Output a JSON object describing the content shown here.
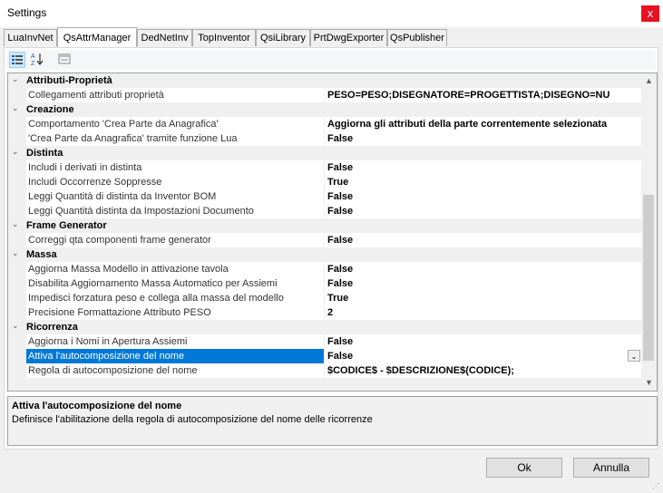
{
  "window": {
    "title": "Settings",
    "close_glyph": "x"
  },
  "tabs": [
    {
      "label": "LuaInvNet"
    },
    {
      "label": "QsAttrManager"
    },
    {
      "label": "DedNetInv"
    },
    {
      "label": "TopInventor"
    },
    {
      "label": "QsiLibrary"
    },
    {
      "label": "PrtDwgExporter"
    },
    {
      "label": "QsPublisher"
    }
  ],
  "toolbar": {
    "categorized_icon": "categorized-icon",
    "alphabetical_icon": "sort-az-icon",
    "pages_icon": "property-pages-icon"
  },
  "grid": {
    "rows": [
      {
        "type": "cat",
        "label": "Attributi-Proprietà"
      },
      {
        "type": "prop",
        "label": "Collegamenti attributi proprietà",
        "value": "PESO=PESO;DISEGNATORE=PROGETTISTA;DISEGNO=NU"
      },
      {
        "type": "cat",
        "label": "Creazione"
      },
      {
        "type": "prop",
        "label": "Comportamento 'Crea Parte da Anagrafica'",
        "value": "Aggiorna gli attributi della parte correntemente selezionata"
      },
      {
        "type": "prop",
        "label": "'Crea Parte da Anagrafica' tramite funzione Lua",
        "value": "False"
      },
      {
        "type": "cat",
        "label": "Distinta"
      },
      {
        "type": "prop",
        "label": "Includi i derivati in distinta",
        "value": "False"
      },
      {
        "type": "prop",
        "label": "Includi Occorrenze Soppresse",
        "value": "True"
      },
      {
        "type": "prop",
        "label": "Leggi Quantità di distinta da Inventor BOM",
        "value": "False"
      },
      {
        "type": "prop",
        "label": "Leggi Quantità distinta da Impostazioni Documento",
        "value": "False"
      },
      {
        "type": "cat",
        "label": "Frame Generator"
      },
      {
        "type": "prop",
        "label": "Correggi qta componenti frame generator",
        "value": "False"
      },
      {
        "type": "cat",
        "label": "Massa"
      },
      {
        "type": "prop",
        "label": "Aggiorna Massa Modello in attivazione tavola",
        "value": "False"
      },
      {
        "type": "prop",
        "label": "Disabilita Aggiornamento Massa Automatico per Assiemi",
        "value": "False"
      },
      {
        "type": "prop",
        "label": "Impedisci forzatura peso e collega alla massa del modello",
        "value": "True"
      },
      {
        "type": "prop",
        "label": "Precisione Formattazione Attributo PESO",
        "value": "2"
      },
      {
        "type": "cat",
        "label": "Ricorrenza"
      },
      {
        "type": "prop",
        "label": "Aggiorna i Nomi in Apertura Assiemi",
        "value": "False"
      },
      {
        "type": "prop",
        "label": "Attiva l'autocomposizione del nome",
        "value": "False",
        "selected": true
      },
      {
        "type": "prop",
        "label": "Regola di autocomposizione del nome",
        "value": "$CODICE$ - $DESCRIZIONE$(CODICE);"
      }
    ]
  },
  "description": {
    "title": "Attiva l'autocomposizione del nome",
    "text": "Definisce l'abilitazione della regola di autocomposizione del nome delle ricorrenze"
  },
  "buttons": {
    "ok": "Ok",
    "cancel": "Annulla"
  }
}
